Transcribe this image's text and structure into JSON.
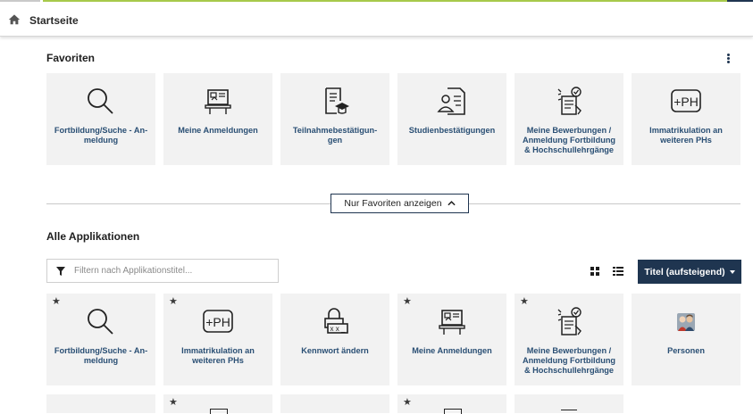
{
  "breadcrumb": {
    "home_icon": "home-icon",
    "label": "Startseite"
  },
  "favorites": {
    "title": "Favoriten",
    "menu_icon": "kebab-menu-icon",
    "tiles": [
      {
        "icon": "search-icon",
        "label": "Fortbildung/Suche - An-meldung"
      },
      {
        "icon": "presentation-board-icon",
        "label": "Meine Anmeldungen"
      },
      {
        "icon": "document-graduation-icon",
        "label": "Teilnahmebestätigun-gen"
      },
      {
        "icon": "certificate-person-icon",
        "label": "Studienbestätigungen"
      },
      {
        "icon": "application-checklist-icon",
        "label": "Meine Bewerbungen / Anmeldung Fortbildung & Hochschullehrgänge"
      },
      {
        "icon": "plus-ph-icon",
        "label": "Immatrikulation an weiteren PHs"
      }
    ]
  },
  "toggle": {
    "label": "Nur Favoriten anzeigen"
  },
  "all_apps": {
    "title": "Alle Applikationen",
    "filter_placeholder": "Filtern nach Applikationstitel...",
    "sort_label": "Titel (aufsteigend)",
    "star_glyph": "★",
    "tiles": [
      {
        "icon": "search-icon",
        "label": "Fortbildung/Suche - An-meldung",
        "starred": true
      },
      {
        "icon": "plus-ph-icon",
        "label": "Immatrikulation an weiteren PHs",
        "starred": true
      },
      {
        "icon": "lock-password-icon",
        "label": "Kennwort ändern",
        "starred": false
      },
      {
        "icon": "presentation-board-icon",
        "label": "Meine Anmeldungen",
        "starred": true
      },
      {
        "icon": "application-checklist-icon",
        "label": "Meine Bewerbungen / Anmeldung Fortbildung & Hochschullehrgänge",
        "starred": true
      },
      {
        "icon": "people-icon",
        "label": "Personen",
        "starred": false
      }
    ]
  },
  "colors": {
    "accent_dark": "#1f3550",
    "link_blue": "#2a4f74",
    "tile_bg": "#f2f2f2",
    "top_green": "#a7c94a"
  }
}
